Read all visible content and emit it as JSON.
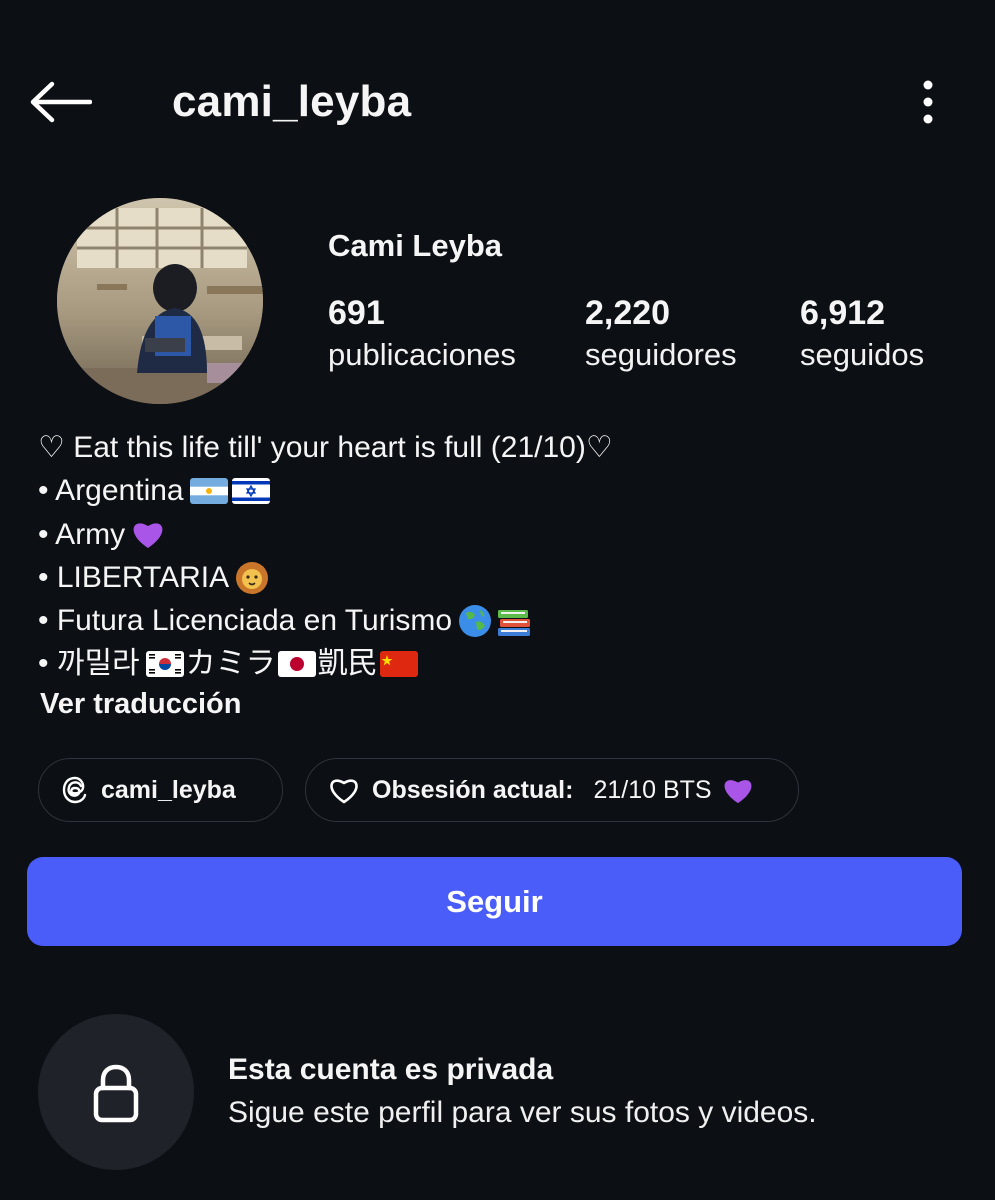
{
  "header": {
    "username": "cami_leyba",
    "back_icon": "arrow-left-icon",
    "more_icon": "vertical-dots-icon"
  },
  "profile": {
    "display_name": "Cami Leyba",
    "stats": [
      {
        "value": "691",
        "label": "publicaciones"
      },
      {
        "value": "2,220",
        "label": "seguidores"
      },
      {
        "value": "6,912",
        "label": "seguidos"
      }
    ]
  },
  "bio": {
    "lines": [
      "♡ Eat this life till' your heart is full (21/10)♡",
      "•  Argentina",
      "• Army",
      "• LIBERTARIA",
      "• Futura Licenciada en Turismo",
      "• 까밀라",
      "カミラ",
      "凱民"
    ],
    "translate_label": "Ver traducción"
  },
  "chips": {
    "threads_handle": "cami_leyba",
    "obsession_label": "Obsesión actual:",
    "obsession_value": "21/10 BTS"
  },
  "follow_button": {
    "label": "Seguir",
    "color": "#4a5df9"
  },
  "private_notice": {
    "title": "Esta cuenta es privada",
    "subtitle": "Sigue este perfil para ver sus fotos y videos.",
    "icon": "lock-icon"
  }
}
